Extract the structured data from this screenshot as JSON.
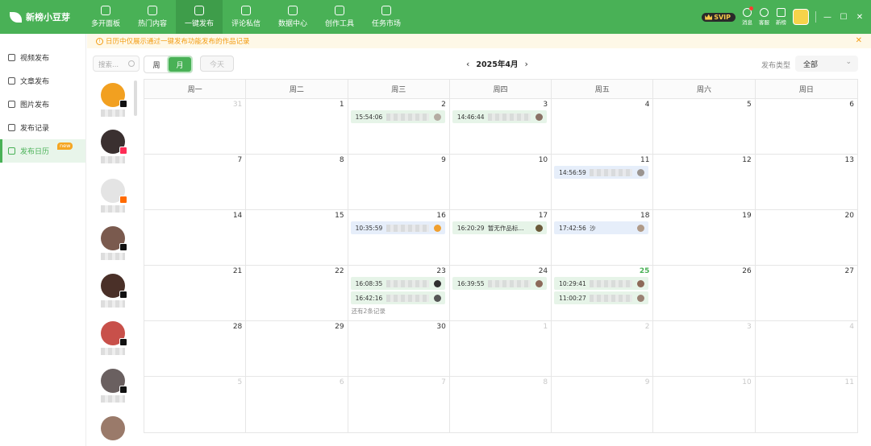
{
  "app": {
    "name": "新榜小豆芽"
  },
  "nav": [
    {
      "label": "多开面板"
    },
    {
      "label": "热门内容"
    },
    {
      "label": "一键发布"
    },
    {
      "label": "评论私信"
    },
    {
      "label": "数据中心"
    },
    {
      "label": "创作工具"
    },
    {
      "label": "任务市场"
    }
  ],
  "topright": {
    "svip": "SVIP",
    "messages": "消息",
    "service": "客服",
    "new": "新榜"
  },
  "sidebar": {
    "items": [
      {
        "label": "视频发布"
      },
      {
        "label": "文章发布"
      },
      {
        "label": "图片发布"
      },
      {
        "label": "发布记录"
      },
      {
        "label": "发布日历",
        "badge": "new"
      }
    ]
  },
  "notice": {
    "text": "日历中仅展示通过一键发布功能发布的作品记录"
  },
  "accounts": {
    "search_placeholder": "搜索..."
  },
  "toolbar": {
    "week_label": "周",
    "month_label": "月",
    "today_label": "今天",
    "month_title": "2025年4月",
    "type_label": "发布类型",
    "type_value": "全部"
  },
  "calendar": {
    "weekdays": [
      "周一",
      "周二",
      "周三",
      "周四",
      "周五",
      "周六",
      "周日"
    ],
    "days": [
      "31",
      "1",
      "2",
      "3",
      "4",
      "5",
      "6",
      "7",
      "8",
      "9",
      "10",
      "11",
      "12",
      "13",
      "14",
      "15",
      "16",
      "17",
      "18",
      "19",
      "20",
      "21",
      "22",
      "23",
      "24",
      "25",
      "26",
      "27",
      "28",
      "29",
      "30",
      "1",
      "2",
      "3",
      "4",
      "5",
      "6",
      "7",
      "8",
      "9",
      "10",
      "11"
    ],
    "today_index": 25,
    "events": {
      "2": [
        {
          "time": "15:54:06",
          "color": "green",
          "thumb": "#b5aca3"
        }
      ],
      "3": [
        {
          "time": "14:46:44",
          "color": "green",
          "thumb": "#8a7266"
        }
      ],
      "11": [
        {
          "time": "14:56:59",
          "color": "blue",
          "thumb": "#9a9490"
        }
      ],
      "16": [
        {
          "time": "10:35:59",
          "color": "blue",
          "thumb": "#f0a030"
        }
      ],
      "17": [
        {
          "time": "16:20:29",
          "color": "green",
          "title": "暂无作品标...",
          "thumb": "#6b5a3a"
        }
      ],
      "18": [
        {
          "time": "17:42:56",
          "color": "blue",
          "title": "沙",
          "thumb": "#b09a88"
        }
      ],
      "23": [
        {
          "time": "16:08:35",
          "color": "green",
          "thumb": "#2f2f2f"
        },
        {
          "time": "16:42:16",
          "color": "green",
          "thumb": "#555555"
        }
      ],
      "24": [
        {
          "time": "16:39:55",
          "color": "green",
          "thumb": "#8c6a5a"
        }
      ],
      "25": [
        {
          "time": "10:29:41",
          "color": "green",
          "thumb": "#8d6a58"
        },
        {
          "time": "11:00:27",
          "color": "green",
          "thumb": "#9a8274"
        }
      ]
    },
    "more": {
      "23": "还有2条记录"
    }
  },
  "colors": {
    "brand": "#49b156",
    "notice": "#f39c12"
  }
}
